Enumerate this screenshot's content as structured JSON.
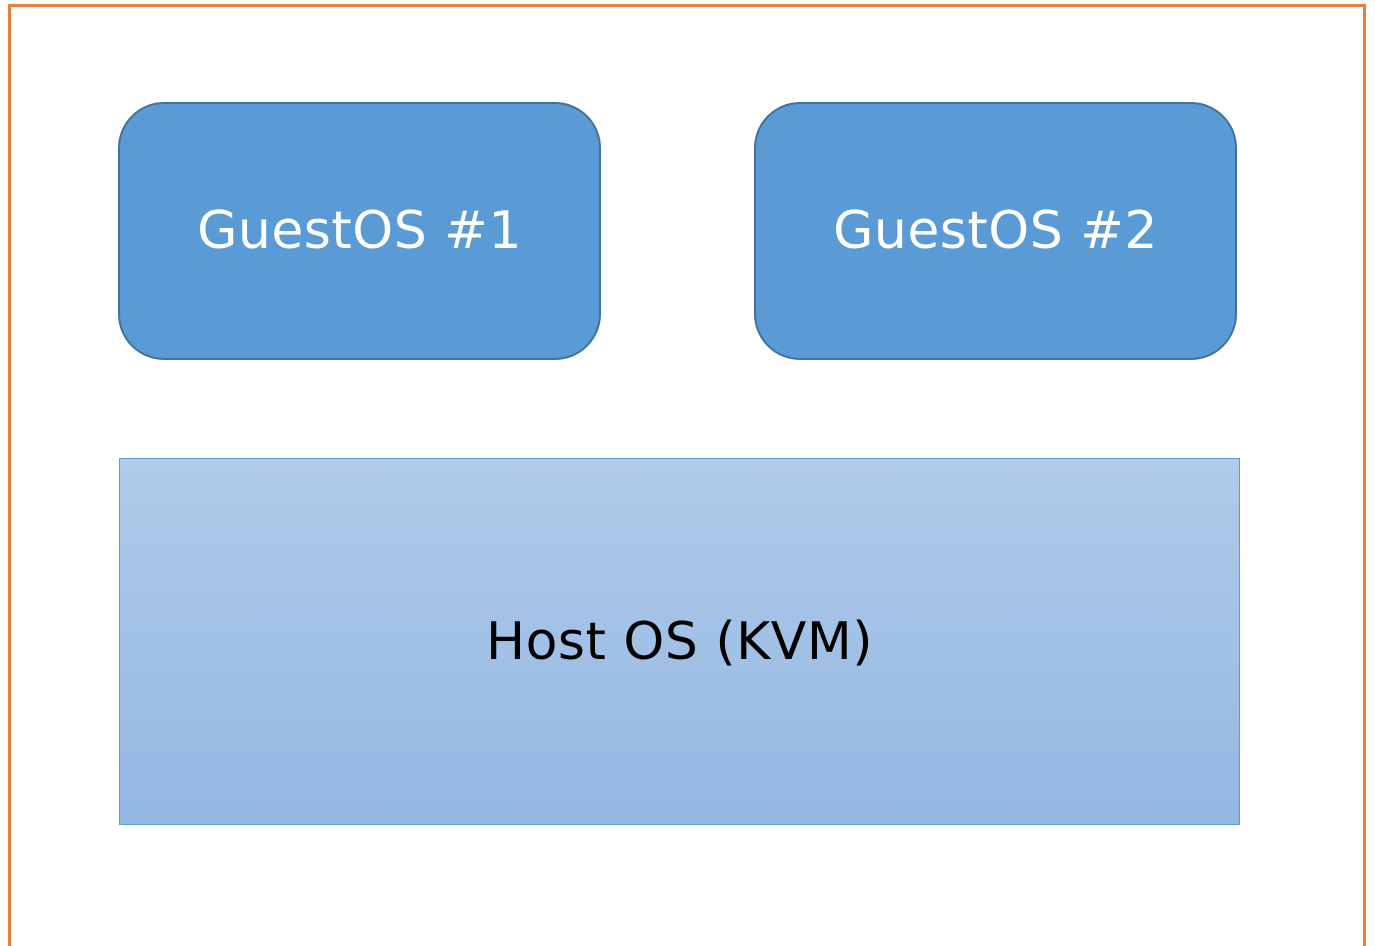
{
  "boxes": {
    "guest1": {
      "label": "GuestOS #1"
    },
    "guest2": {
      "label": "GuestOS #2"
    },
    "host": {
      "label": "Host OS (KVM)"
    }
  },
  "colors": {
    "frame_border": "#e8823a",
    "guest_fill": "#5b9bd5",
    "guest_border": "#41719c",
    "guest_text": "#ffffff",
    "host_fill_top": "#b0cbea",
    "host_fill_bottom": "#93b7e3",
    "host_border": "#5b9bd5",
    "host_text": "#000000"
  }
}
